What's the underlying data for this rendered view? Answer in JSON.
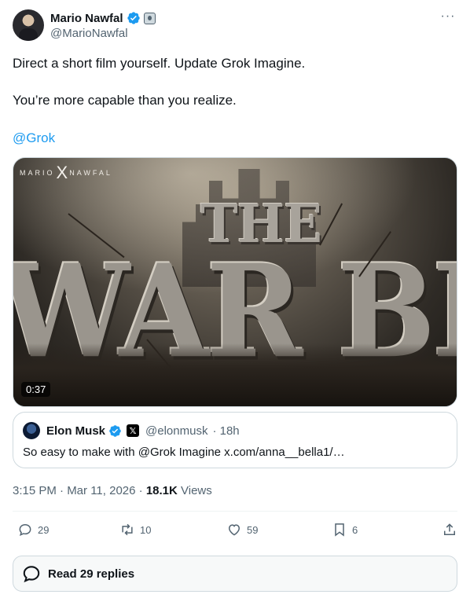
{
  "author": {
    "display_name": "Mario Nawfal",
    "handle": "@MarioNawfal",
    "verified_icon": "verified-badge-icon",
    "affiliation_icon": "affiliate-badge-icon"
  },
  "more_icon_glyph": "···",
  "tweet": {
    "line1": "Direct a short film yourself. Update Grok Imagine.",
    "line2": "You’re more capable than you realize.",
    "mention": "@Grok"
  },
  "media": {
    "watermark_left": "MARIO",
    "watermark_x": "X",
    "watermark_right": "NAWFAL",
    "title_small": "THE",
    "title_large": "WAR BEAST",
    "duration": "0:37"
  },
  "quote": {
    "name": "Elon Musk",
    "x_badge": "𝕏",
    "handle": "@elonmusk",
    "time": "· 18h",
    "text": "So easy to make with @Grok Imagine x.com/anna__bella1/…"
  },
  "meta": {
    "timestamp": "3:15 PM · Mar 11, 2026 ·",
    "views_count": "18.1K",
    "views_label": "Views"
  },
  "actions": {
    "replies": "29",
    "reposts": "10",
    "likes": "59",
    "bookmarks": "6"
  },
  "read_replies_label": "Read 29 replies",
  "colors": {
    "accent": "#1d9bf0",
    "text_primary": "#0f1419",
    "text_secondary": "#536471",
    "border": "#cfd9de"
  }
}
